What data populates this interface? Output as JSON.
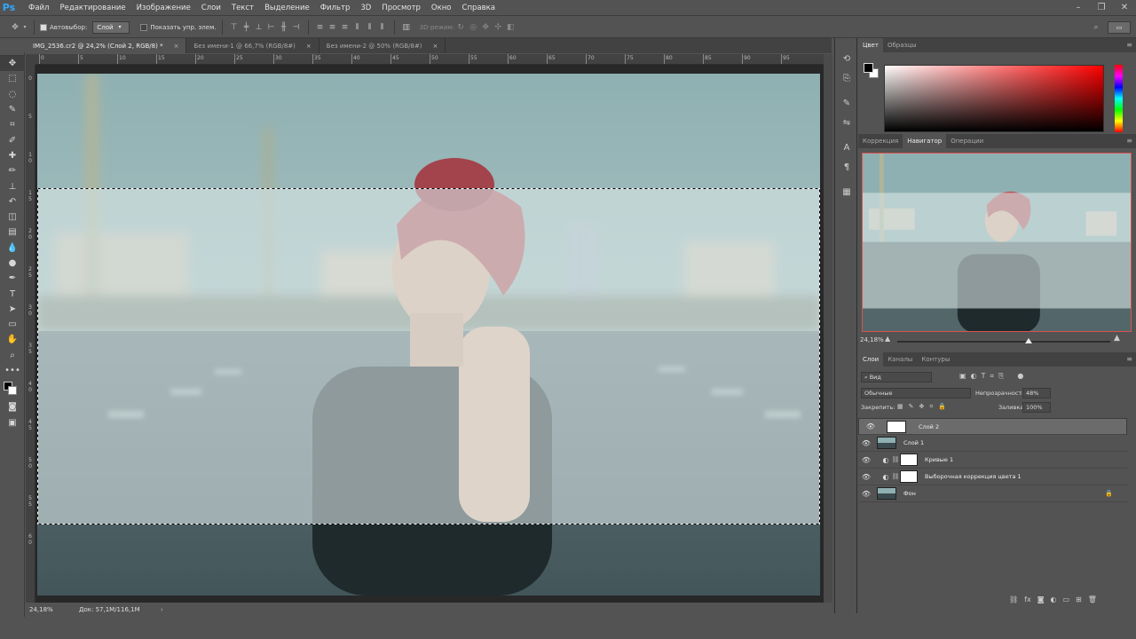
{
  "menu": {
    "logo": "Ps",
    "items": [
      "Файл",
      "Редактирование",
      "Изображение",
      "Слои",
      "Текст",
      "Выделение",
      "Фильтр",
      "3D",
      "Просмотр",
      "Окно",
      "Справка"
    ]
  },
  "options": {
    "autoselect_label": "Автовыбор:",
    "autoselect_value": "Слой",
    "show_controls_label": "Показать упр. элем.",
    "mode_3d_label": "3D-режим:"
  },
  "tabs": [
    {
      "label": "IMG_2536.cr2 @ 24,2% (Слой 2, RGB/8) *",
      "close": "×"
    },
    {
      "label": "Без имени-1 @ 66,7% (RGB/8#)",
      "close": "×"
    },
    {
      "label": "Без имени-2 @ 50% (RGB/8#)",
      "close": "×"
    }
  ],
  "ruler_top": [
    "0",
    "5",
    "10",
    "15",
    "20",
    "25",
    "30",
    "35",
    "40",
    "45",
    "50",
    "55",
    "60",
    "65",
    "70",
    "75",
    "80",
    "85",
    "90",
    "95"
  ],
  "ruler_left": [
    "0",
    "5",
    "1 0",
    "1 5",
    "2 0",
    "2 5",
    "3 0",
    "3 5",
    "4 0",
    "4 5",
    "5 0",
    "5 5",
    "6 0"
  ],
  "status": {
    "zoom": "24,18%",
    "doc": "Док: 57,1M/116,1M",
    "arrow": "›"
  },
  "color_panel": {
    "tabs": [
      "Цвет",
      "Образцы"
    ],
    "fg_color": "#000000",
    "bg_color": "#ffffff"
  },
  "nav_panel": {
    "tabs": [
      "Коррекция",
      "Навигатор",
      "Операции"
    ],
    "zoom": "24,18%"
  },
  "layers_panel": {
    "tabs": [
      "Слои",
      "Каналы",
      "Контуры"
    ],
    "filter": "Вид",
    "blend_mode": "Обычные",
    "opacity_label": "Непрозрачность:",
    "opacity_value": "48%",
    "lock_label": "Закрепить:",
    "fill_label": "Заливка:",
    "fill_value": "100%",
    "layers": [
      {
        "name": "Слой 2",
        "type": "pixel-white",
        "selected": true
      },
      {
        "name": "Слой 1",
        "type": "pixel-photo",
        "selected": false
      },
      {
        "name": "Кривые 1",
        "type": "adjustment",
        "selected": false
      },
      {
        "name": "Выборочная коррекция цвета 1",
        "type": "adjustment",
        "selected": false
      },
      {
        "name": "Фон",
        "type": "background",
        "selected": false,
        "locked": true
      }
    ]
  },
  "colors": {
    "ps_blue": "#31a8ff",
    "nav_border": "#d9534f",
    "selection_overlay": "#c9dadb"
  }
}
